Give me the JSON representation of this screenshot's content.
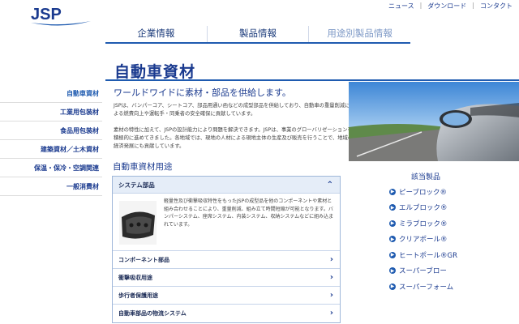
{
  "brand": {
    "logo_text": "JSP"
  },
  "utility": {
    "news": "ニュース",
    "download": "ダウンロード",
    "contact": "コンタクト",
    "separator": "|"
  },
  "gnav": {
    "tabs": [
      {
        "label": "企業情報"
      },
      {
        "label": "製品情報"
      },
      {
        "label": "用途別製品情報"
      }
    ]
  },
  "sidebar": {
    "items": [
      {
        "label": "自動車資材"
      },
      {
        "label": "工業用包装材"
      },
      {
        "label": "食品用包装材"
      },
      {
        "label": "建築資材／土木資材"
      },
      {
        "label": "保温・保冷・空調関連"
      },
      {
        "label": "一般消費材"
      }
    ]
  },
  "main": {
    "title": "自動車資材",
    "subtitle": "ワールドワイドに素材・部品を供給します。",
    "desc1": "JSPは、バンパーコア、シートコア、部品用通い函などの成型部品を供給しており、自動車の重量削減による燃費向上や運転手・同乗者の安全確保に貢献しています。",
    "desc2": "素材の特性に加えて、JSPの設計能力により問題を解決できます。JSPは、事業のグローバリゼーションを積極的に進めてきました。各地域では、現地の人材による現地主体の生産及び販売を行うことで、地域の経済発展にも貢献しています。",
    "section_title": "自動車資材用途",
    "accordion": {
      "open_head": "システム部品",
      "open_text": "軽量性及び衝撃吸収特性をもったJSPの成型品を他のコンポーネントや素材と組み合わせることにより、重量削減、組み立て時間短縮が可能となります。バンパーシステム、座席システム、内装システム、収納システムなどに組み込まれています。",
      "rows": [
        {
          "label": "コンポーネント部品"
        },
        {
          "label": "衝撃吸収用途"
        },
        {
          "label": "歩行者保護用途"
        },
        {
          "label": "自動車部品の物流システム"
        }
      ]
    }
  },
  "related": {
    "title": "該当製品",
    "products": [
      {
        "label": "ピーブロック®"
      },
      {
        "label": "エルブロック®"
      },
      {
        "label": "ミラブロック®"
      },
      {
        "label": "クリアポール®"
      },
      {
        "label": "ヒートポール®GR"
      },
      {
        "label": "スーパーブロー"
      },
      {
        "label": "スーパーフォーム"
      }
    ]
  },
  "colors": {
    "brand_blue": "#1a3a8f",
    "accent_blue": "#1f5bb0",
    "accordion_header": "#e5edf8"
  }
}
